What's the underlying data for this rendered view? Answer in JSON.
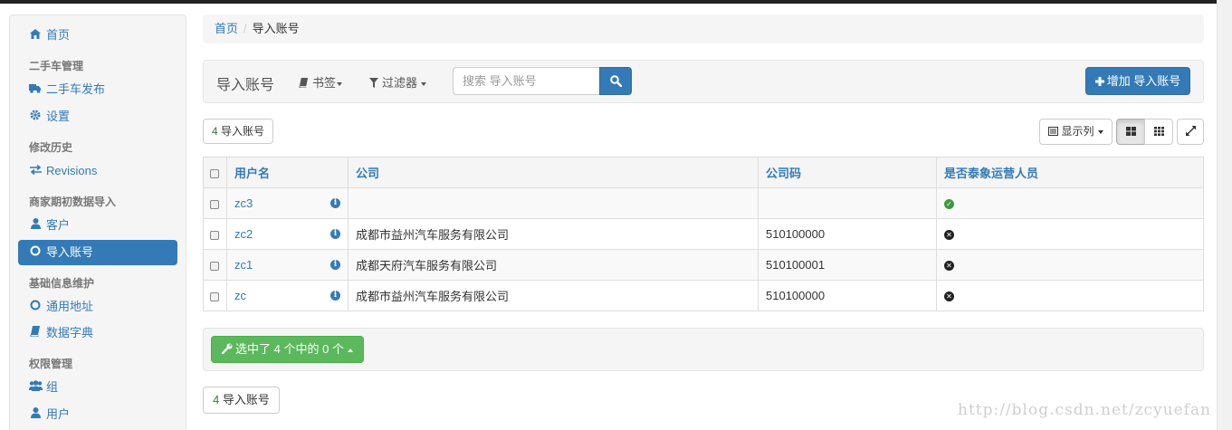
{
  "sidebar": {
    "home": "首页",
    "group1": "二手车管理",
    "car_publish": "二手车发布",
    "settings": "设置",
    "group2": "修改历史",
    "revisions": "Revisions",
    "group3": "商家期初数据导入",
    "customers": "客户",
    "import_accounts": "导入账号",
    "group4": "基础信息维护",
    "common_address": "通用地址",
    "data_dict": "数据字典",
    "group5": "权限管理",
    "groups": "组",
    "users": "用户"
  },
  "breadcrumb": {
    "home": "首页",
    "separator": "/",
    "current": "导入账号"
  },
  "toolbar": {
    "title": "导入账号",
    "bookmarks": "书签",
    "filters": "过滤器",
    "search_placeholder": "搜索 导入账号",
    "add_button": "增加 导入账号"
  },
  "count_top": {
    "num": "4",
    "label": "导入账号"
  },
  "view_controls": {
    "columns": "显示列"
  },
  "table": {
    "headers": [
      "用户名",
      "公司",
      "公司码",
      "是否泰象运营人员"
    ],
    "rows": [
      {
        "username": "zc3",
        "company": "",
        "code": "",
        "is_operator": true
      },
      {
        "username": "zc2",
        "company": "成都市益州汽车服务有限公司",
        "code": "510100000",
        "is_operator": false
      },
      {
        "username": "zc1",
        "company": "成都天府汽车服务有限公司",
        "code": "510100001",
        "is_operator": false
      },
      {
        "username": "zc",
        "company": "成都市益州汽车服务有限公司",
        "code": "510100000",
        "is_operator": false
      }
    ]
  },
  "actions": {
    "selected_label": "选中了 4 个中的 0 个"
  },
  "count_bottom": {
    "num": "4",
    "label": "导入账号"
  },
  "watermark": "http://blog.csdn.net/zcyuefan",
  "colors": {
    "primary": "#337ab7",
    "success": "#5cb85c",
    "panel": "#f5f5f5"
  }
}
